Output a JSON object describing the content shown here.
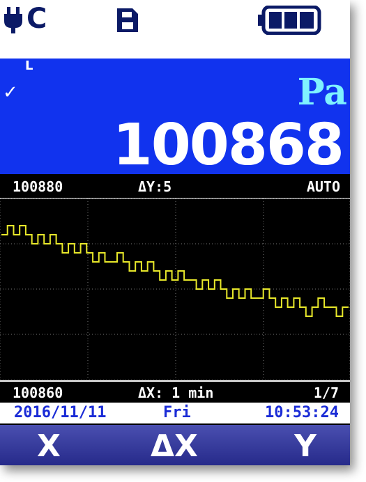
{
  "status": {
    "connection_text": "C"
  },
  "readout": {
    "marker": "L",
    "unit": "Pa",
    "value": "100868"
  },
  "graph": {
    "top_value": "100880",
    "delta_y": "ΔY:5",
    "scale_mode": "AUTO",
    "bottom_value": "100860",
    "delta_x": "ΔX: 1 min",
    "page": "1/7"
  },
  "datetime": {
    "date": "2016/11/11",
    "weekday": "Fri",
    "time": "10:53:24"
  },
  "softkeys": {
    "left": "X",
    "middle": "ΔX",
    "right": "Y"
  },
  "battery_level": 1.0,
  "chart_data": {
    "type": "line",
    "ylim": [
      100860,
      100880
    ],
    "series": [
      {
        "color": "#e8e82a",
        "values": [
          100876,
          100877,
          100876,
          100877,
          100876,
          100875,
          100876,
          100875,
          100876,
          100875,
          100874,
          100875,
          100874,
          100875,
          100874,
          100873,
          100874,
          100873,
          100873,
          100874,
          100873,
          100872,
          100873,
          100872,
          100873,
          100872,
          100871,
          100872,
          100871,
          100872,
          100871,
          100871,
          100870,
          100871,
          100870,
          100871,
          100870,
          100869,
          100870,
          100869,
          100870,
          100869,
          100869,
          100870,
          100869,
          100868,
          100869,
          100868,
          100869,
          100868,
          100867,
          100868,
          100869,
          100868,
          100868,
          100867,
          100868
        ]
      }
    ],
    "colors": {
      "line": "#e8e82a",
      "grid": "#777777"
    }
  }
}
